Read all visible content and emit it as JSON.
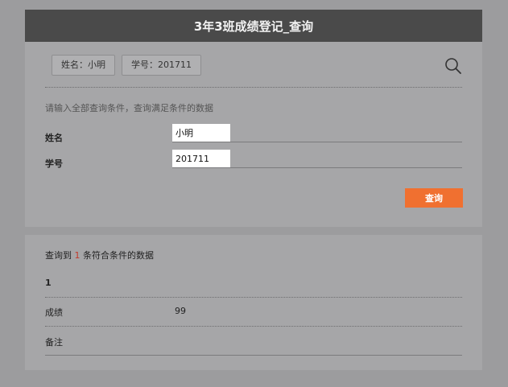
{
  "header": {
    "title": "3年3班成绩登记_查询"
  },
  "chips": [
    {
      "label": "姓名：小明"
    },
    {
      "label": "学号：201711"
    }
  ],
  "icons": {
    "search": "search-icon"
  },
  "form": {
    "hint": "请输入全部查询条件，查询满足条件的数据",
    "name_label": "姓名",
    "name_value": "小明",
    "id_label": "学号",
    "id_value": "201711",
    "query_button": "查询"
  },
  "result": {
    "summary_prefix": "查询到",
    "count": "1",
    "summary_suffix": "条符合条件的数据",
    "record_index": "1",
    "score_label": "成绩",
    "score_value": "99",
    "note_label": "备注",
    "note_value": ""
  },
  "colors": {
    "header_bg": "#4a4a4a",
    "panel_bg": "#a6a6a8",
    "button_bg": "#f07030",
    "count_color": "#c0392b"
  }
}
